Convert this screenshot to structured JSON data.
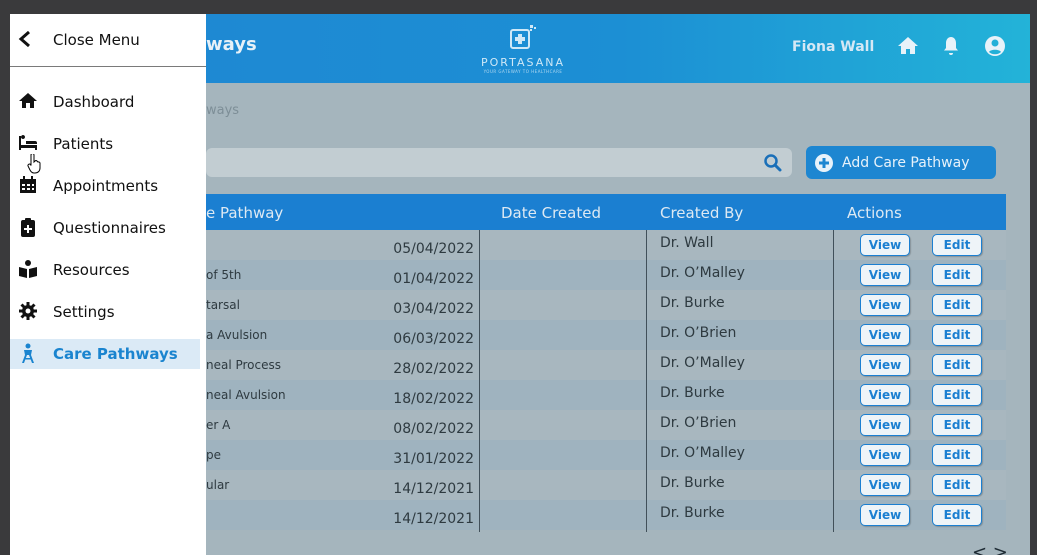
{
  "header": {
    "page_title": "ways",
    "logo_name": "PORTASANA",
    "logo_tagline": "YOUR GATEWAY TO HEALTHCARE",
    "user_name": "Fiona Wall",
    "icons": [
      "home-icon",
      "bell-icon",
      "account-icon"
    ]
  },
  "breadcrumb": "ways",
  "search": {
    "placeholder": ""
  },
  "add_button_label": "Add Care Pathway",
  "table": {
    "headers": [
      "e Pathway",
      "Date Created",
      "Created By",
      "Actions"
    ],
    "rows": [
      {
        "pathway": "",
        "date": "05/04/2022",
        "by": "Dr. Wall"
      },
      {
        "pathway": "of 5th",
        "date": "01/04/2022",
        "by": "Dr. O’Malley"
      },
      {
        "pathway": "tarsal",
        "date": "03/04/2022",
        "by": "Dr. Burke"
      },
      {
        "pathway": "a Avulsion",
        "date": "06/03/2022",
        "by": "Dr. O’Brien"
      },
      {
        "pathway": "neal Process",
        "date": "28/02/2022",
        "by": "Dr. O’Malley"
      },
      {
        "pathway": "neal Avulsion",
        "date": "18/02/2022",
        "by": "Dr. Burke"
      },
      {
        "pathway": "er A",
        "date": "08/02/2022",
        "by": "Dr. O’Brien"
      },
      {
        "pathway": "pe",
        "date": "31/01/2022",
        "by": "Dr. O’Malley"
      },
      {
        "pathway": "ular",
        "date": "14/12/2021",
        "by": "Dr. Burke"
      },
      {
        "pathway": "",
        "date": "14/12/2021",
        "by": "Dr. Burke"
      }
    ],
    "view_label": "View",
    "edit_label": "Edit"
  },
  "pager": "< >",
  "drawer": {
    "close_label": "Close Menu",
    "items": [
      {
        "label": "Dashboard",
        "icon": "home-icon"
      },
      {
        "label": "Patients",
        "icon": "bed-icon"
      },
      {
        "label": "Appointments",
        "icon": "calendar-icon"
      },
      {
        "label": "Questionnaires",
        "icon": "clipboard-plus-icon"
      },
      {
        "label": "Resources",
        "icon": "book-reader-icon"
      },
      {
        "label": "Settings",
        "icon": "gear-icon"
      },
      {
        "label": "Care Pathways",
        "icon": "person-pathway-icon",
        "active": true
      }
    ]
  },
  "colors": {
    "primary": "#1b7fd1",
    "overlay": "#a5b5bd",
    "active_text": "#1a84cf"
  }
}
